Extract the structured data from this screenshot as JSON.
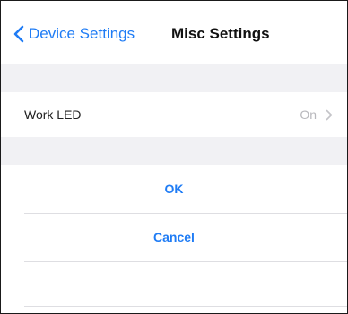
{
  "nav": {
    "back_label": "Device Settings",
    "title": "Misc Settings",
    "back_icon": "chevron-left-icon"
  },
  "settings": {
    "work_led_label": "Work LED",
    "work_led_value": "On",
    "disclosure_icon": "chevron-right-icon"
  },
  "actions": {
    "ok_label": "OK",
    "cancel_label": "Cancel"
  },
  "colors": {
    "accent": "#1f7cf5",
    "group_background": "#f1f1f4",
    "value_text": "#b8b8bc",
    "separator": "#dedee2"
  }
}
